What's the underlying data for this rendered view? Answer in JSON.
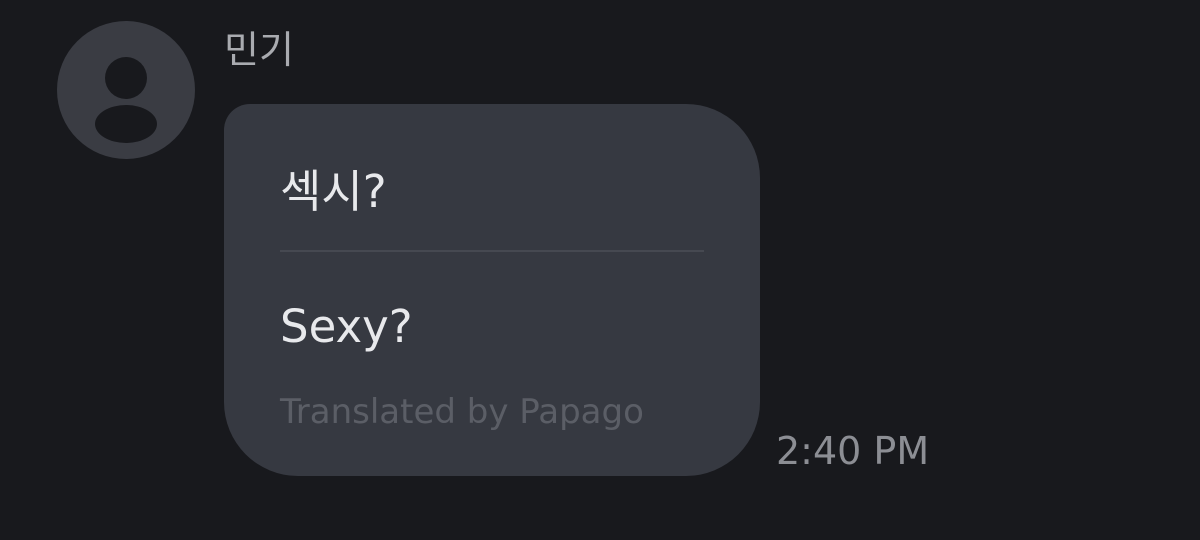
{
  "message": {
    "sender_name": "민기",
    "avatar_icon": "person-silhouette-icon",
    "original_text": "섹시?",
    "translated_text": "Sexy?",
    "translation_credit": "Translated by Papago",
    "timestamp": "2:40 PM"
  },
  "colors": {
    "background": "#18191d",
    "bubble": "#363941",
    "avatar": "#3a3c43",
    "avatar_figure": "#18191d",
    "message_text": "#e8e9ec",
    "credit_text": "#5b5e66",
    "timestamp_text": "#8c8e94"
  }
}
